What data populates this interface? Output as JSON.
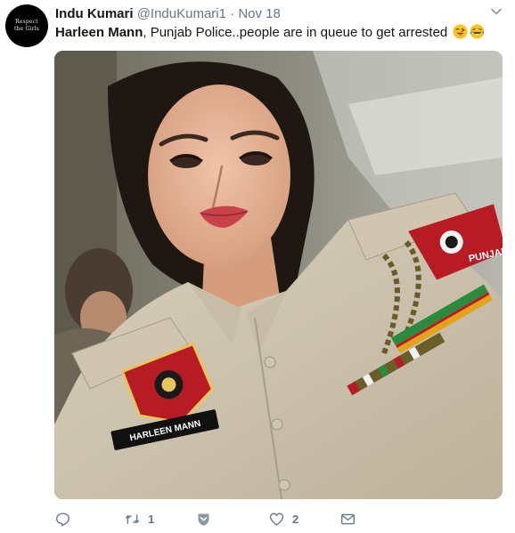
{
  "avatar": {
    "line1": "Respect",
    "line2": "the Girls"
  },
  "header": {
    "display_name": "Indu Kumari",
    "handle": "@InduKumari1",
    "separator": "·",
    "timestamp": "Nov 18"
  },
  "tweet": {
    "mention": "Harleen Mann",
    "text": ", Punjab Police..people are in queue to get arrested"
  },
  "photo": {
    "name_plate": "HARLEEN MANN",
    "shoulder_badge": "PUNJAB"
  },
  "actions": {
    "reply_count": "",
    "retweet_count": "1",
    "like_count": "2"
  },
  "colors": {
    "text_primary": "#14171a",
    "text_secondary": "#657786"
  },
  "icons": [
    "caret-down-icon",
    "tongue-wink-emoji",
    "laughing-tears-emoji",
    "reply-icon",
    "retweet-icon",
    "shield-icon",
    "heart-icon",
    "message-icon"
  ]
}
